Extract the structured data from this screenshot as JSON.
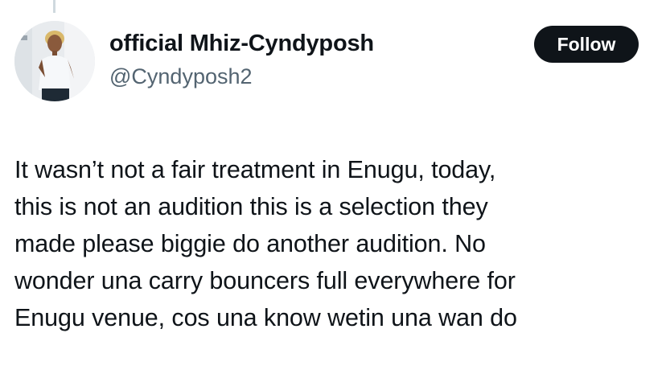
{
  "author": {
    "display_name": "official Mhiz-Cyndyposh",
    "handle": "@Cyndyposh2",
    "avatar_icon": "profile-photo"
  },
  "actions": {
    "follow_label": "Follow"
  },
  "tweet": {
    "text": "It wasn’t not a fair treatment in Enugu, today,\nthis is not an audition this is a selection they\nmade please biggie do another audition. No\nwonder una carry bouncers full everywhere for\nEnugu venue, cos una know wetin una wan do"
  },
  "colors": {
    "text_primary": "#0f1419",
    "text_secondary": "#536471",
    "button_bg": "#0f1419",
    "button_text": "#ffffff",
    "thread_line": "#cfd9de"
  }
}
